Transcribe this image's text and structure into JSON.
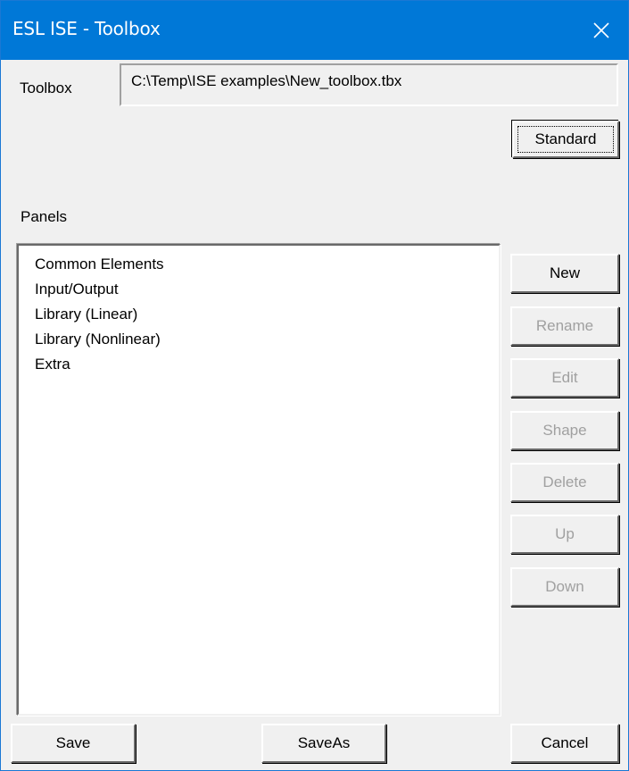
{
  "window": {
    "title": "ESL ISE - Toolbox",
    "close_glyph": "✕"
  },
  "toolbox": {
    "label": "Toolbox",
    "path": "C:\\Temp\\ISE examples\\New_toolbox.tbx"
  },
  "buttons": {
    "standard": "Standard",
    "new": "New",
    "rename": "Rename",
    "edit": "Edit",
    "shape": "Shape",
    "delete": "Delete",
    "up": "Up",
    "down": "Down",
    "save": "Save",
    "save_as": "SaveAs",
    "cancel": "Cancel"
  },
  "panels": {
    "label": "Panels",
    "items": [
      "Common Elements",
      "Input/Output",
      "Library (Linear)",
      "Library (Nonlinear)",
      "Extra"
    ]
  },
  "colors": {
    "titlebar": "#0078d7",
    "face": "#f0f0f0",
    "disabled_text": "#a0a0a0"
  },
  "icons": {
    "close": "close-icon"
  }
}
